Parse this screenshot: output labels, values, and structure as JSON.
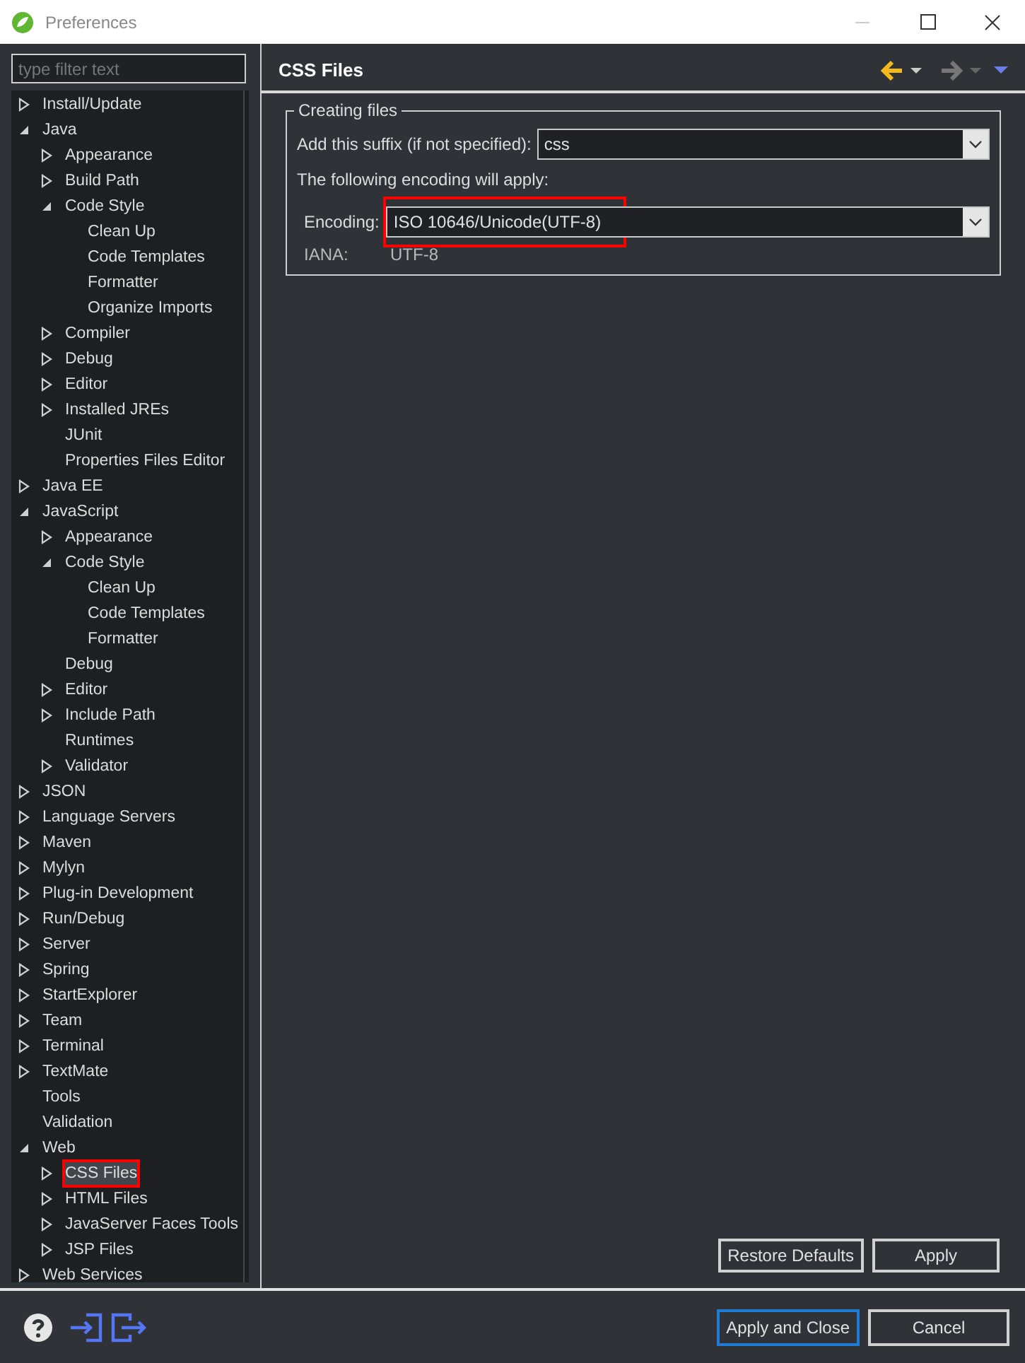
{
  "window": {
    "title": "Preferences"
  },
  "filter": {
    "placeholder": "type filter text"
  },
  "tree": [
    {
      "label": "Install/Update",
      "expanded": false,
      "selected": false
    },
    {
      "label": "Java",
      "expanded": true,
      "selected": false,
      "children": [
        {
          "label": "Appearance",
          "expanded": false,
          "selected": false
        },
        {
          "label": "Build Path",
          "expanded": false,
          "selected": false
        },
        {
          "label": "Code Style",
          "expanded": true,
          "selected": false,
          "children": [
            {
              "label": "Clean Up",
              "selected": false
            },
            {
              "label": "Code Templates",
              "selected": false
            },
            {
              "label": "Formatter",
              "selected": false
            },
            {
              "label": "Organize Imports",
              "selected": false
            }
          ]
        },
        {
          "label": "Compiler",
          "expanded": false,
          "selected": false
        },
        {
          "label": "Debug",
          "expanded": false,
          "selected": false
        },
        {
          "label": "Editor",
          "expanded": false,
          "selected": false
        },
        {
          "label": "Installed JREs",
          "expanded": false,
          "selected": false
        },
        {
          "label": "JUnit",
          "selected": false
        },
        {
          "label": "Properties Files Editor",
          "selected": false
        }
      ]
    },
    {
      "label": "Java EE",
      "expanded": false,
      "selected": false
    },
    {
      "label": "JavaScript",
      "expanded": true,
      "selected": false,
      "children": [
        {
          "label": "Appearance",
          "expanded": false,
          "selected": false
        },
        {
          "label": "Code Style",
          "expanded": true,
          "selected": false,
          "children": [
            {
              "label": "Clean Up",
              "selected": false
            },
            {
              "label": "Code Templates",
              "selected": false
            },
            {
              "label": "Formatter",
              "selected": false
            }
          ]
        },
        {
          "label": "Debug",
          "selected": false
        },
        {
          "label": "Editor",
          "expanded": false,
          "selected": false
        },
        {
          "label": "Include Path",
          "expanded": false,
          "selected": false
        },
        {
          "label": "Runtimes",
          "selected": false
        },
        {
          "label": "Validator",
          "expanded": false,
          "selected": false
        }
      ]
    },
    {
      "label": "JSON",
      "expanded": false,
      "selected": false
    },
    {
      "label": "Language Servers",
      "expanded": false,
      "selected": false
    },
    {
      "label": "Maven",
      "expanded": false,
      "selected": false
    },
    {
      "label": "Mylyn",
      "expanded": false,
      "selected": false
    },
    {
      "label": "Plug-in Development",
      "expanded": false,
      "selected": false
    },
    {
      "label": "Run/Debug",
      "expanded": false,
      "selected": false
    },
    {
      "label": "Server",
      "expanded": false,
      "selected": false
    },
    {
      "label": "Spring",
      "expanded": false,
      "selected": false
    },
    {
      "label": "StartExplorer",
      "expanded": false,
      "selected": false
    },
    {
      "label": "Team",
      "expanded": false,
      "selected": false
    },
    {
      "label": "Terminal",
      "expanded": false,
      "selected": false
    },
    {
      "label": "TextMate",
      "expanded": false,
      "selected": false
    },
    {
      "label": "Tools",
      "selected": false
    },
    {
      "label": "Validation",
      "selected": false
    },
    {
      "label": "Web",
      "expanded": true,
      "selected": false,
      "children": [
        {
          "label": "CSS Files",
          "expanded": false,
          "selected": true,
          "highlighted": true
        },
        {
          "label": "HTML Files",
          "expanded": false,
          "selected": false
        },
        {
          "label": "JavaServer Faces Tools",
          "expanded": false,
          "selected": false
        },
        {
          "label": "JSP Files",
          "expanded": false,
          "selected": false
        }
      ]
    },
    {
      "label": "Web Services",
      "expanded": false,
      "selected": false
    }
  ],
  "page": {
    "title": "CSS Files",
    "group": {
      "title": "Creating files",
      "suffix": {
        "label": "Add this suffix (if not specified):",
        "value": "css"
      },
      "note": "The following encoding will apply:",
      "encoding": {
        "label": "Encoding:",
        "value": "ISO 10646/Unicode(UTF-8)",
        "highlighted": true
      },
      "iana": {
        "label": "IANA:",
        "value": "UTF-8"
      }
    },
    "buttons": [
      "Restore Defaults",
      "Apply"
    ]
  },
  "footer_buttons": [
    {
      "label": "Apply and Close",
      "focused": true
    },
    {
      "label": "Cancel",
      "focused": false
    }
  ]
}
